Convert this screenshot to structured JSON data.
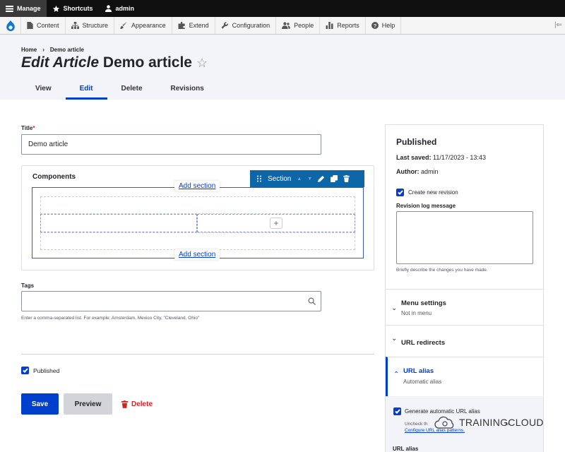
{
  "toolbar": {
    "manage": "Manage",
    "shortcuts": "Shortcuts",
    "user": "admin"
  },
  "tray": {
    "items": [
      "Content",
      "Structure",
      "Appearance",
      "Extend",
      "Configuration",
      "People",
      "Reports",
      "Help"
    ]
  },
  "header": {
    "breadcrumb": {
      "home": "Home",
      "current": "Demo article"
    },
    "title_italic": "Edit Article",
    "title_rest": "Demo article",
    "tabs": [
      "View",
      "Edit",
      "Delete",
      "Revisions"
    ]
  },
  "form": {
    "title_label": "Title",
    "title_required": "*",
    "title_value": "Demo article",
    "components_label": "Components",
    "add_section": "Add section",
    "section_label": "Section",
    "tags_label": "Tags",
    "tags_value": "",
    "tags_description": "Enter a comma-separated list. For example: Amsterdam, Mexico City, \"Cleveland, Ohio\"",
    "published_label": "Published",
    "save": "Save",
    "preview": "Preview",
    "delete": "Delete"
  },
  "sidebar": {
    "status": "Published",
    "last_saved_label": "Last saved:",
    "last_saved_value": "11/17/2023 - 13:43",
    "author_label": "Author:",
    "author_value": "admin",
    "create_revision": "Create new revision",
    "revision_log_label": "Revision log message",
    "revision_log_desc": "Briefly describe the changes you have made.",
    "menu_settings": "Menu settings",
    "menu_settings_sub": "Not in menu",
    "url_redirects": "URL redirects",
    "url_alias": "URL alias",
    "url_alias_sub": "Automatic alias",
    "generate_alias": "Generate automatic URL alias",
    "alias_desc_visible": "Uncheck th",
    "alias_desc_tail": "w.",
    "configure_alias": "Configure URL alias patterns.",
    "url_alias_field_label": "URL alias"
  },
  "watermark": "TRAININGCLOUD",
  "colors": {
    "accent": "#003ecc",
    "toolbar": "#0f0f0f",
    "section_bar": "#0d66a8",
    "danger": "#d72222"
  }
}
